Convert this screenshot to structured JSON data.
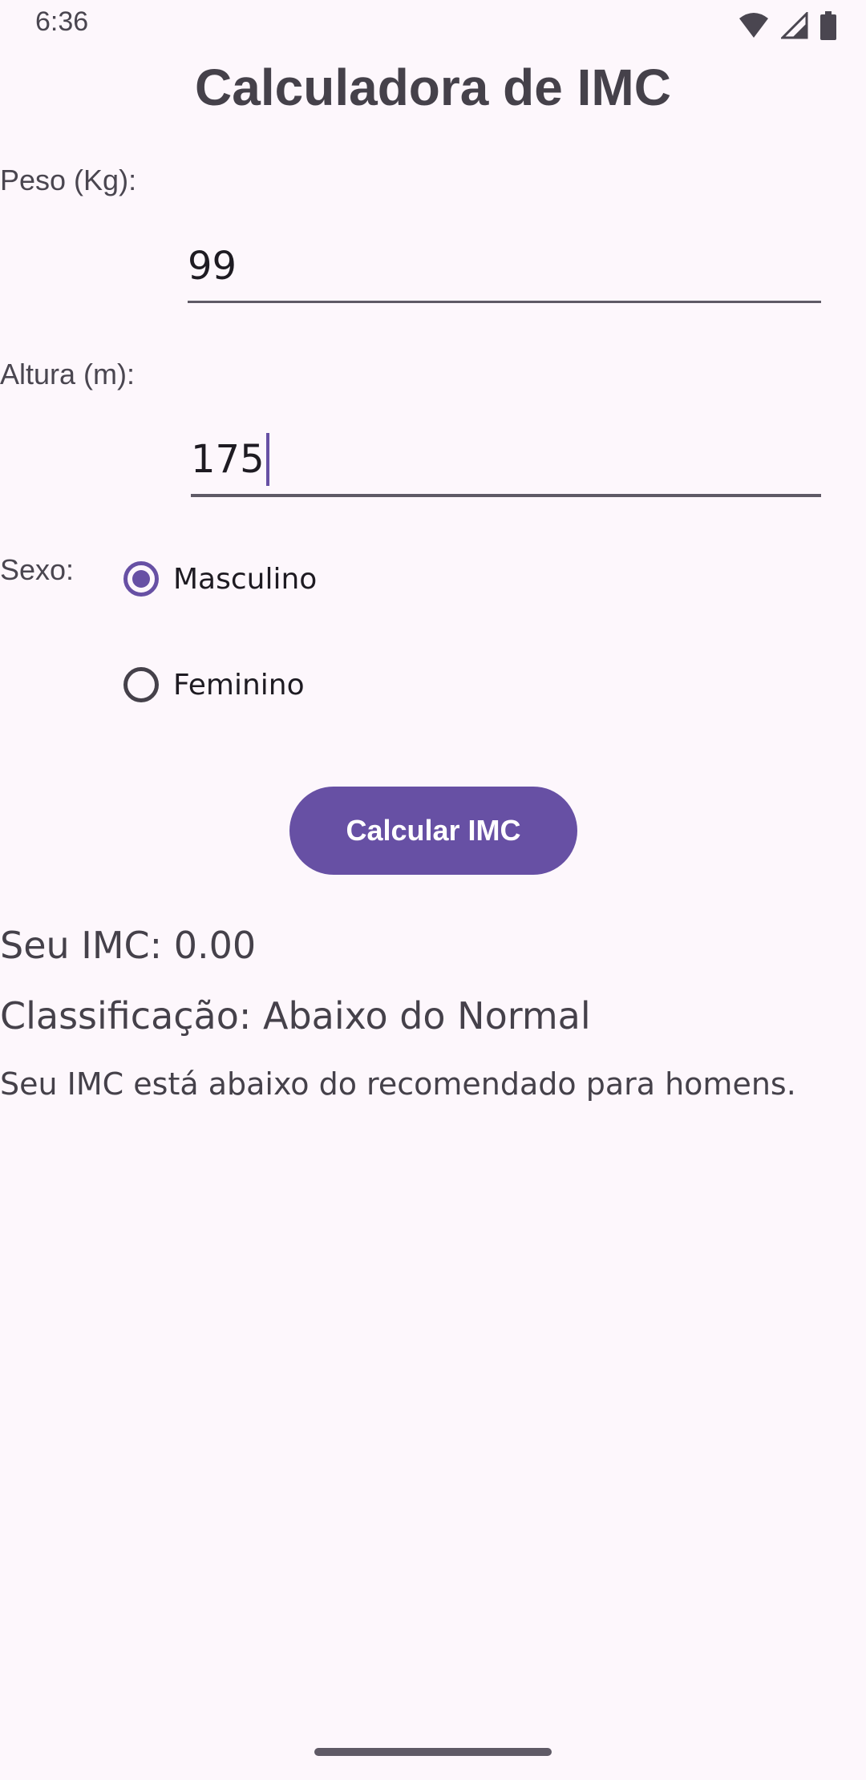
{
  "status_bar": {
    "time": "6:36",
    "icons": [
      "wifi-icon",
      "signal-icon",
      "battery-icon"
    ]
  },
  "title": "Calculadora de IMC",
  "weight": {
    "label": "Peso (Kg):",
    "value": "99"
  },
  "height": {
    "label": "Altura (m):",
    "value": "175"
  },
  "sex": {
    "label": "Sexo:",
    "options": [
      {
        "label": "Masculino",
        "checked": true
      },
      {
        "label": "Feminino",
        "checked": false
      }
    ]
  },
  "button": {
    "label": "Calcular IMC"
  },
  "results": {
    "imc": "Seu IMC: 0.00",
    "classification": "Classificação: Abaixo do Normal",
    "message": "Seu IMC está abaixo do recomendado para homens."
  },
  "colors": {
    "accent": "#6750a4",
    "background": "#fdf7fc",
    "text": "#45414a"
  }
}
